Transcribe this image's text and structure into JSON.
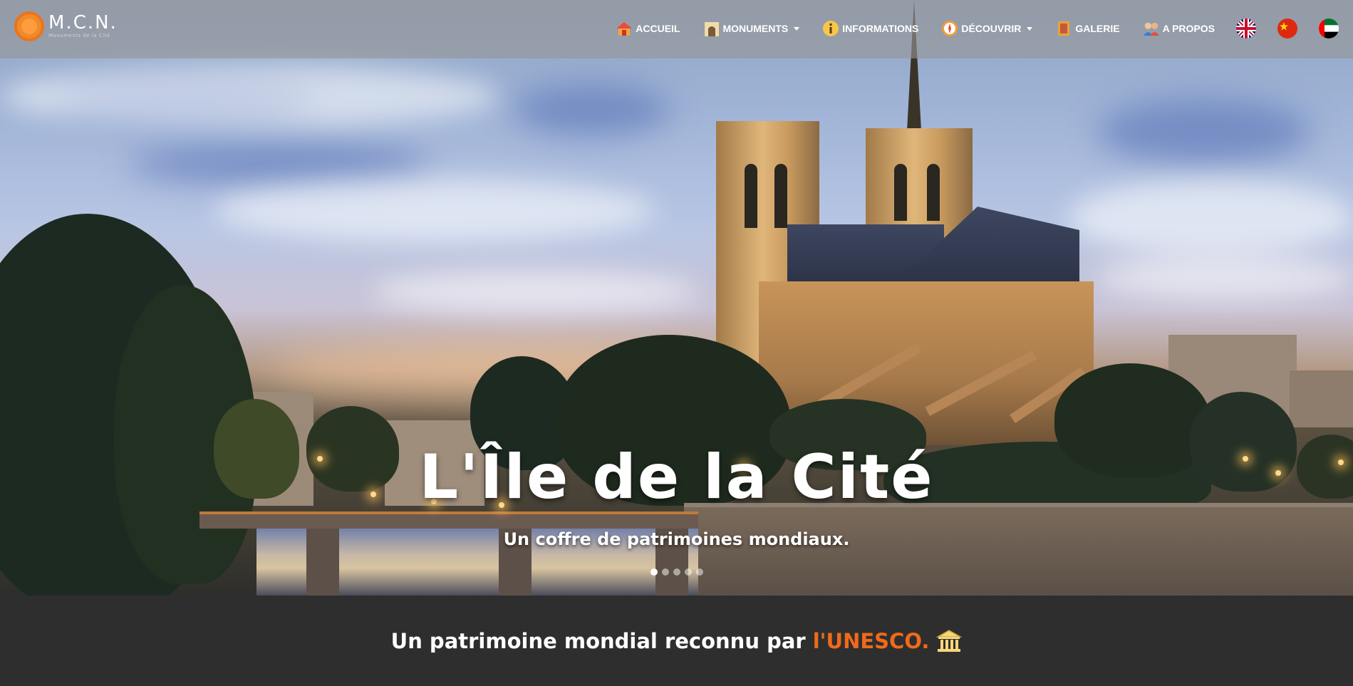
{
  "brand": {
    "name": "M.C.N.",
    "subtitle": "Monuments de la Cité"
  },
  "nav": {
    "items": [
      {
        "label": "Accueil",
        "icon": "home-icon",
        "dropdown": false
      },
      {
        "label": "Monuments",
        "icon": "monument-icon",
        "dropdown": true
      },
      {
        "label": "Informations",
        "icon": "info-icon",
        "dropdown": false
      },
      {
        "label": "Découvrir",
        "icon": "compass-icon",
        "dropdown": true
      },
      {
        "label": "Galerie",
        "icon": "gallery-icon",
        "dropdown": false
      },
      {
        "label": "A propos",
        "icon": "people-icon",
        "dropdown": false
      }
    ],
    "languages": [
      {
        "name": "english-flag-icon"
      },
      {
        "name": "chinese-flag-icon"
      },
      {
        "name": "uae-flag-icon"
      }
    ]
  },
  "hero": {
    "title": "L'Île de la Cité",
    "subtitle": "Un coffre de patrimoines mondiaux.",
    "slides": 5,
    "active_slide": 1
  },
  "banner": {
    "text": "Un patrimoine mondial reconnu par",
    "accent": "l'UNESCO.",
    "accent_color": "#ee6a1a",
    "icon": "museum-icon"
  }
}
